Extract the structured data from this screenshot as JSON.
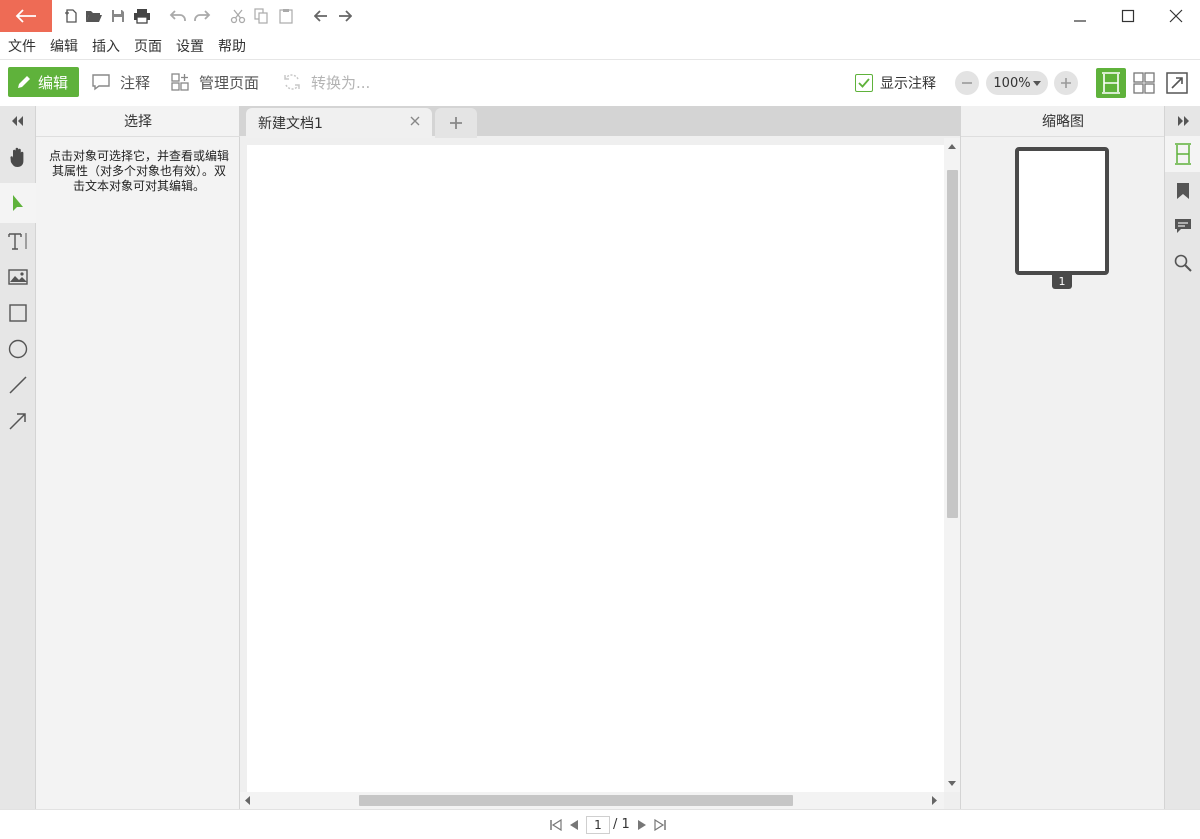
{
  "colors": {
    "accent": "#5fb23b",
    "back_button": "#ee6b55"
  },
  "menu": [
    "文件",
    "编辑",
    "插入",
    "页面",
    "设置",
    "帮助"
  ],
  "toolbar": {
    "edit_label": "编辑",
    "annotate_label": "注释",
    "manage_pages_label": "管理页面",
    "convert_label": "转换为...",
    "show_annotations_label": "显示注释",
    "show_annotations_checked": true,
    "zoom_value": "100%"
  },
  "left_panel": {
    "title": "选择",
    "description": "点击对象可选择它，并查看或编辑其属性（对多个对象也有效）。双击文本对象可对其编辑。",
    "active_tool": "select"
  },
  "document": {
    "tab_title": "新建文档1"
  },
  "right_panel": {
    "title": "缩略图",
    "thumbnail_page_number": "1"
  },
  "status": {
    "current_page": "1",
    "total_pages": "/ 1"
  }
}
